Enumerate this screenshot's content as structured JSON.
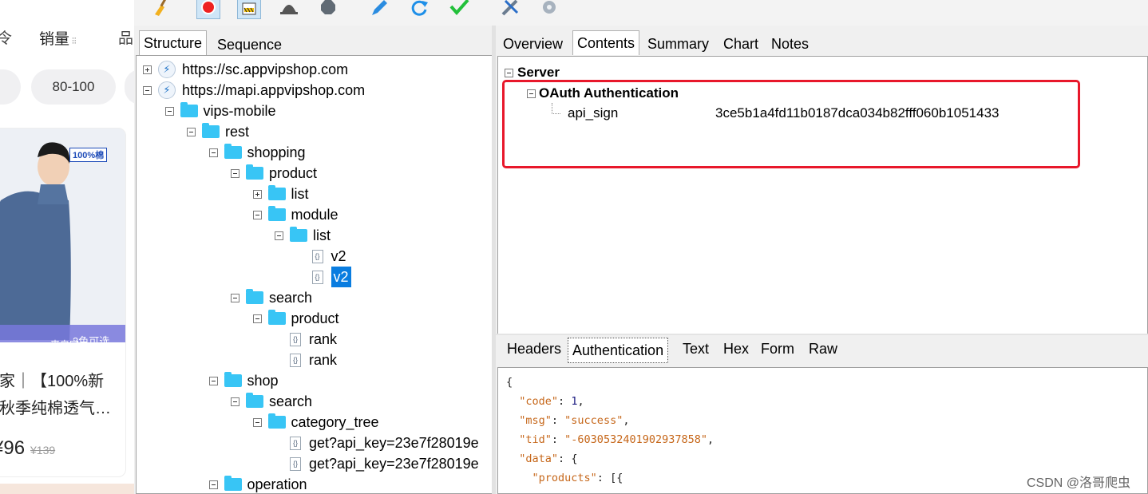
{
  "phone": {
    "tabs": [
      "令",
      "销量",
      "品"
    ],
    "price_chip": "80-100",
    "badge": "100%棉",
    "colors_label": "3色可选",
    "source_label": "来自家",
    "title_line1": "家｜【100%新",
    "title_line2": "秋季纯棉透气…",
    "price": "¥96",
    "orig_price": "¥139"
  },
  "structure": {
    "tabs": {
      "structure": "Structure",
      "sequence": "Sequence"
    },
    "tree": [
      {
        "label": "https://sc.appvipshop.com",
        "type": "host",
        "toggle": "plus",
        "level": 0
      },
      {
        "label": "https://mapi.appvipshop.com",
        "type": "host",
        "toggle": "minus",
        "level": 0
      },
      {
        "label": "vips-mobile",
        "type": "folder",
        "toggle": "minus",
        "level": 1
      },
      {
        "label": "rest",
        "type": "folder",
        "toggle": "minus",
        "level": 2
      },
      {
        "label": "shopping",
        "type": "folder",
        "toggle": "minus",
        "level": 3
      },
      {
        "label": "product",
        "type": "folder",
        "toggle": "minus",
        "level": 4
      },
      {
        "label": "list",
        "type": "folder",
        "toggle": "plus",
        "level": 5
      },
      {
        "label": "module",
        "type": "folder",
        "toggle": "minus",
        "level": 5
      },
      {
        "label": "list",
        "type": "folder",
        "toggle": "minus",
        "level": 6
      },
      {
        "label": "v2",
        "type": "file",
        "level": 7
      },
      {
        "label": "v2",
        "type": "file",
        "level": 7,
        "selected": true
      },
      {
        "label": "search",
        "type": "folder",
        "toggle": "minus",
        "level": 4
      },
      {
        "label": "product",
        "type": "folder",
        "toggle": "minus",
        "level": 5
      },
      {
        "label": "rank",
        "type": "file",
        "level": 6
      },
      {
        "label": "rank",
        "type": "file",
        "level": 6
      },
      {
        "label": "shop",
        "type": "folder",
        "toggle": "minus",
        "level": 3
      },
      {
        "label": "search",
        "type": "folder",
        "toggle": "minus",
        "level": 4
      },
      {
        "label": "category_tree",
        "type": "folder",
        "toggle": "minus",
        "level": 5
      },
      {
        "label": "get?api_key=23e7f28019e",
        "type": "file",
        "level": 6
      },
      {
        "label": "get?api_key=23e7f28019e",
        "type": "file",
        "level": 6
      },
      {
        "label": "operation",
        "type": "folder",
        "toggle": "minus",
        "level": 3
      }
    ]
  },
  "request": {
    "tabs": [
      "Overview",
      "Contents",
      "Summary",
      "Chart",
      "Notes"
    ],
    "active_tab": "Contents",
    "server_label": "Server",
    "oauth_label": "OAuth Authentication",
    "api_sign_key": "api_sign",
    "api_sign_value": "3ce5b1a4fd11b0187dca034b82fff060b1051433",
    "highlight_color": "#e8182b"
  },
  "response": {
    "tabs": [
      "Headers",
      "Authentication",
      "Text",
      "Hex",
      "Form",
      "Raw"
    ],
    "active_tab": "Authentication",
    "json": {
      "open_brace": "{",
      "code_key": "\"code\"",
      "code_val": "1",
      "msg_key": "\"msg\"",
      "msg_val": "\"success\"",
      "tid_key": "\"tid\"",
      "tid_val": "\"-6030532401902937858\"",
      "data_key": "\"data\"",
      "data_open": "{",
      "products_key": "\"products\"",
      "products_open": "[{"
    }
  },
  "watermark": "CSDN @洛哥爬虫"
}
